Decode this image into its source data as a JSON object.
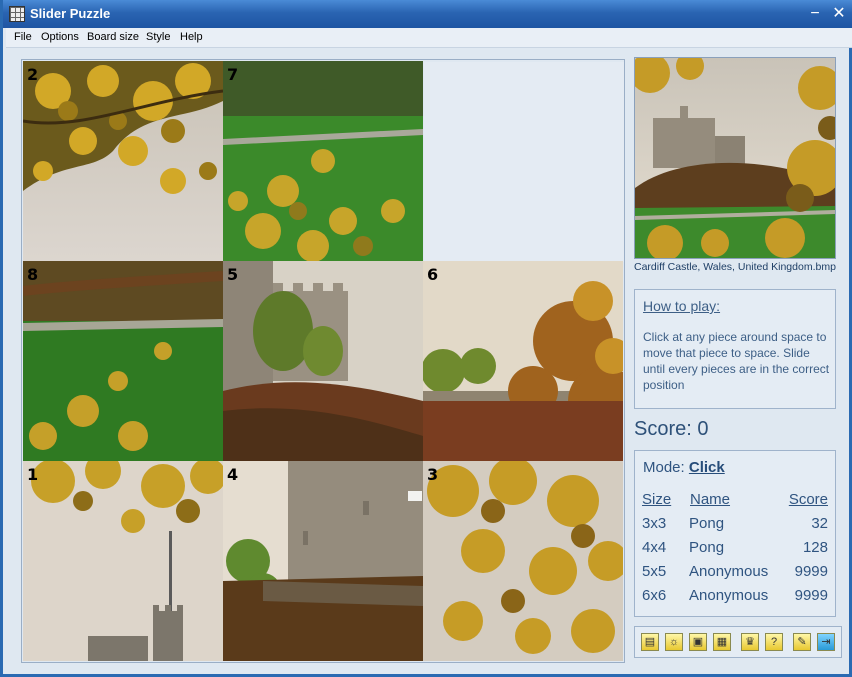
{
  "window": {
    "title": "Slider Puzzle",
    "minimize": "−",
    "close": "✕"
  },
  "menu": [
    "File",
    "Options",
    "Board size",
    "Style",
    "Help"
  ],
  "board": {
    "tiles": [
      {
        "num": "2",
        "row": 0,
        "col": 0,
        "kind": "tree-left"
      },
      {
        "num": "7",
        "row": 0,
        "col": 1,
        "kind": "grass-leaves"
      },
      {
        "num": "8",
        "row": 1,
        "col": 0,
        "kind": "grass-left"
      },
      {
        "num": "5",
        "row": 1,
        "col": 1,
        "kind": "castle-wall"
      },
      {
        "num": "6",
        "row": 1,
        "col": 2,
        "kind": "sky-trees"
      },
      {
        "num": "1",
        "row": 2,
        "col": 0,
        "kind": "flag-castle"
      },
      {
        "num": "4",
        "row": 2,
        "col": 1,
        "kind": "tower"
      },
      {
        "num": "3",
        "row": 2,
        "col": 2,
        "kind": "tree-right"
      }
    ],
    "empty": {
      "row": 0,
      "col": 2
    }
  },
  "preview": {
    "caption": "Cardiff Castle, Wales, United Kingdom.bmp"
  },
  "howto": {
    "heading": "How to play:",
    "text": "Click at any piece around space to move that piece to space. Slide until every pieces are in the correct position"
  },
  "score": "Score: 0",
  "mode": {
    "label": "Mode:",
    "value": "Click"
  },
  "highscores": {
    "headers": {
      "size": "Size",
      "name": "Name",
      "score": "Score"
    },
    "rows": [
      {
        "size": "3x3",
        "name": "Pong",
        "score": "32"
      },
      {
        "size": "4x4",
        "name": "Pong",
        "score": "128"
      },
      {
        "size": "5x5",
        "name": "Anonymous",
        "score": "9999"
      },
      {
        "size": "6x6",
        "name": "Anonymous",
        "score": "9999"
      }
    ]
  },
  "toolbar_icons": [
    "new-game-icon",
    "hint-icon",
    "open-image-icon",
    "image-list-icon",
    "highscores-icon",
    "help-icon",
    "settings-icon",
    "exit-icon"
  ]
}
